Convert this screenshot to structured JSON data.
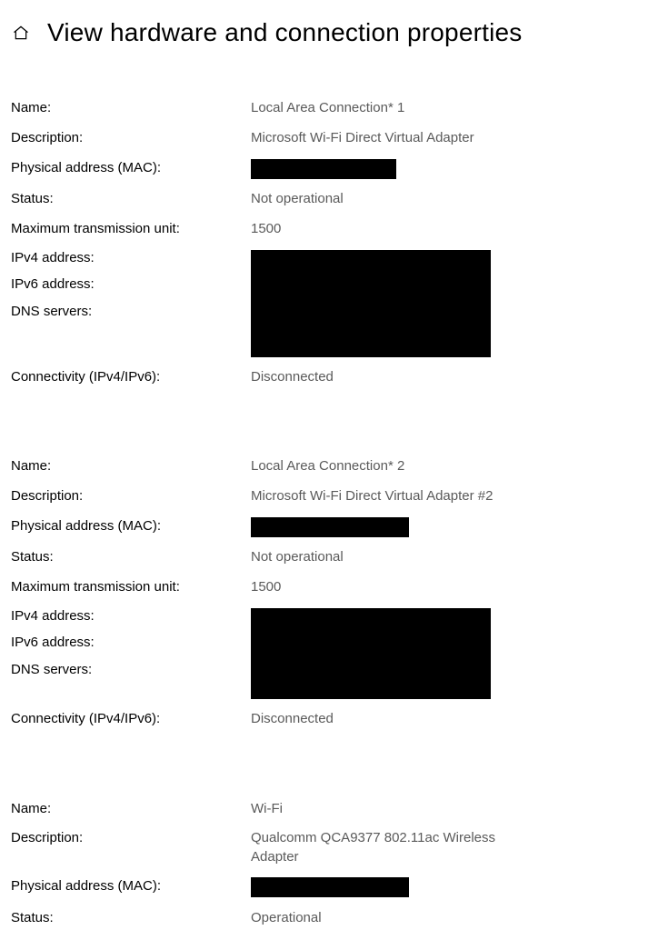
{
  "header": {
    "title": "View hardware and connection properties"
  },
  "labels": {
    "name": "Name:",
    "description": "Description:",
    "mac": "Physical address (MAC):",
    "status": "Status:",
    "mtu": "Maximum transmission unit:",
    "ipv4": "IPv4 address:",
    "ipv6": "IPv6 address:",
    "dns": "DNS servers:",
    "connectivity": "Connectivity (IPv4/IPv6):"
  },
  "adapters": [
    {
      "name": "Local Area Connection* 1",
      "description": "Microsoft Wi-Fi Direct Virtual Adapter",
      "mac_redacted": true,
      "status": "Not operational",
      "mtu": "1500",
      "addresses_redacted": true,
      "connectivity": "Disconnected"
    },
    {
      "name": "Local Area Connection* 2",
      "description": "Microsoft Wi-Fi Direct Virtual Adapter #2",
      "mac_redacted": true,
      "status": "Not operational",
      "mtu": "1500",
      "addresses_redacted": true,
      "connectivity": "Disconnected"
    },
    {
      "name": "Wi-Fi",
      "description": "Qualcomm QCA9377 802.11ac Wireless Adapter",
      "mac_redacted": true,
      "status": "Operational"
    }
  ]
}
